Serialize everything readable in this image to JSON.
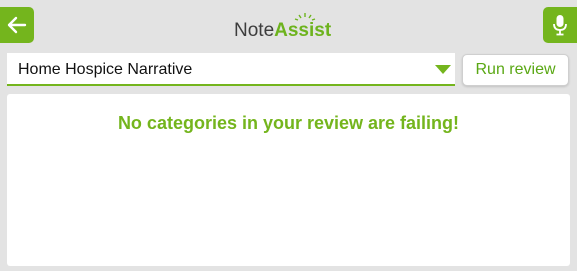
{
  "header": {
    "logo_part1": "Note",
    "logo_part2": "Assist",
    "back_icon": "arrow-left-icon",
    "mic_icon": "microphone-icon"
  },
  "selector": {
    "value": "Home Hospice Narrative"
  },
  "actions": {
    "run_review_label": "Run review"
  },
  "results": {
    "message": "No categories in your review are failing!"
  },
  "colors": {
    "accent": "#74b51d",
    "background": "#e3e3e3",
    "panel": "#ffffff"
  }
}
